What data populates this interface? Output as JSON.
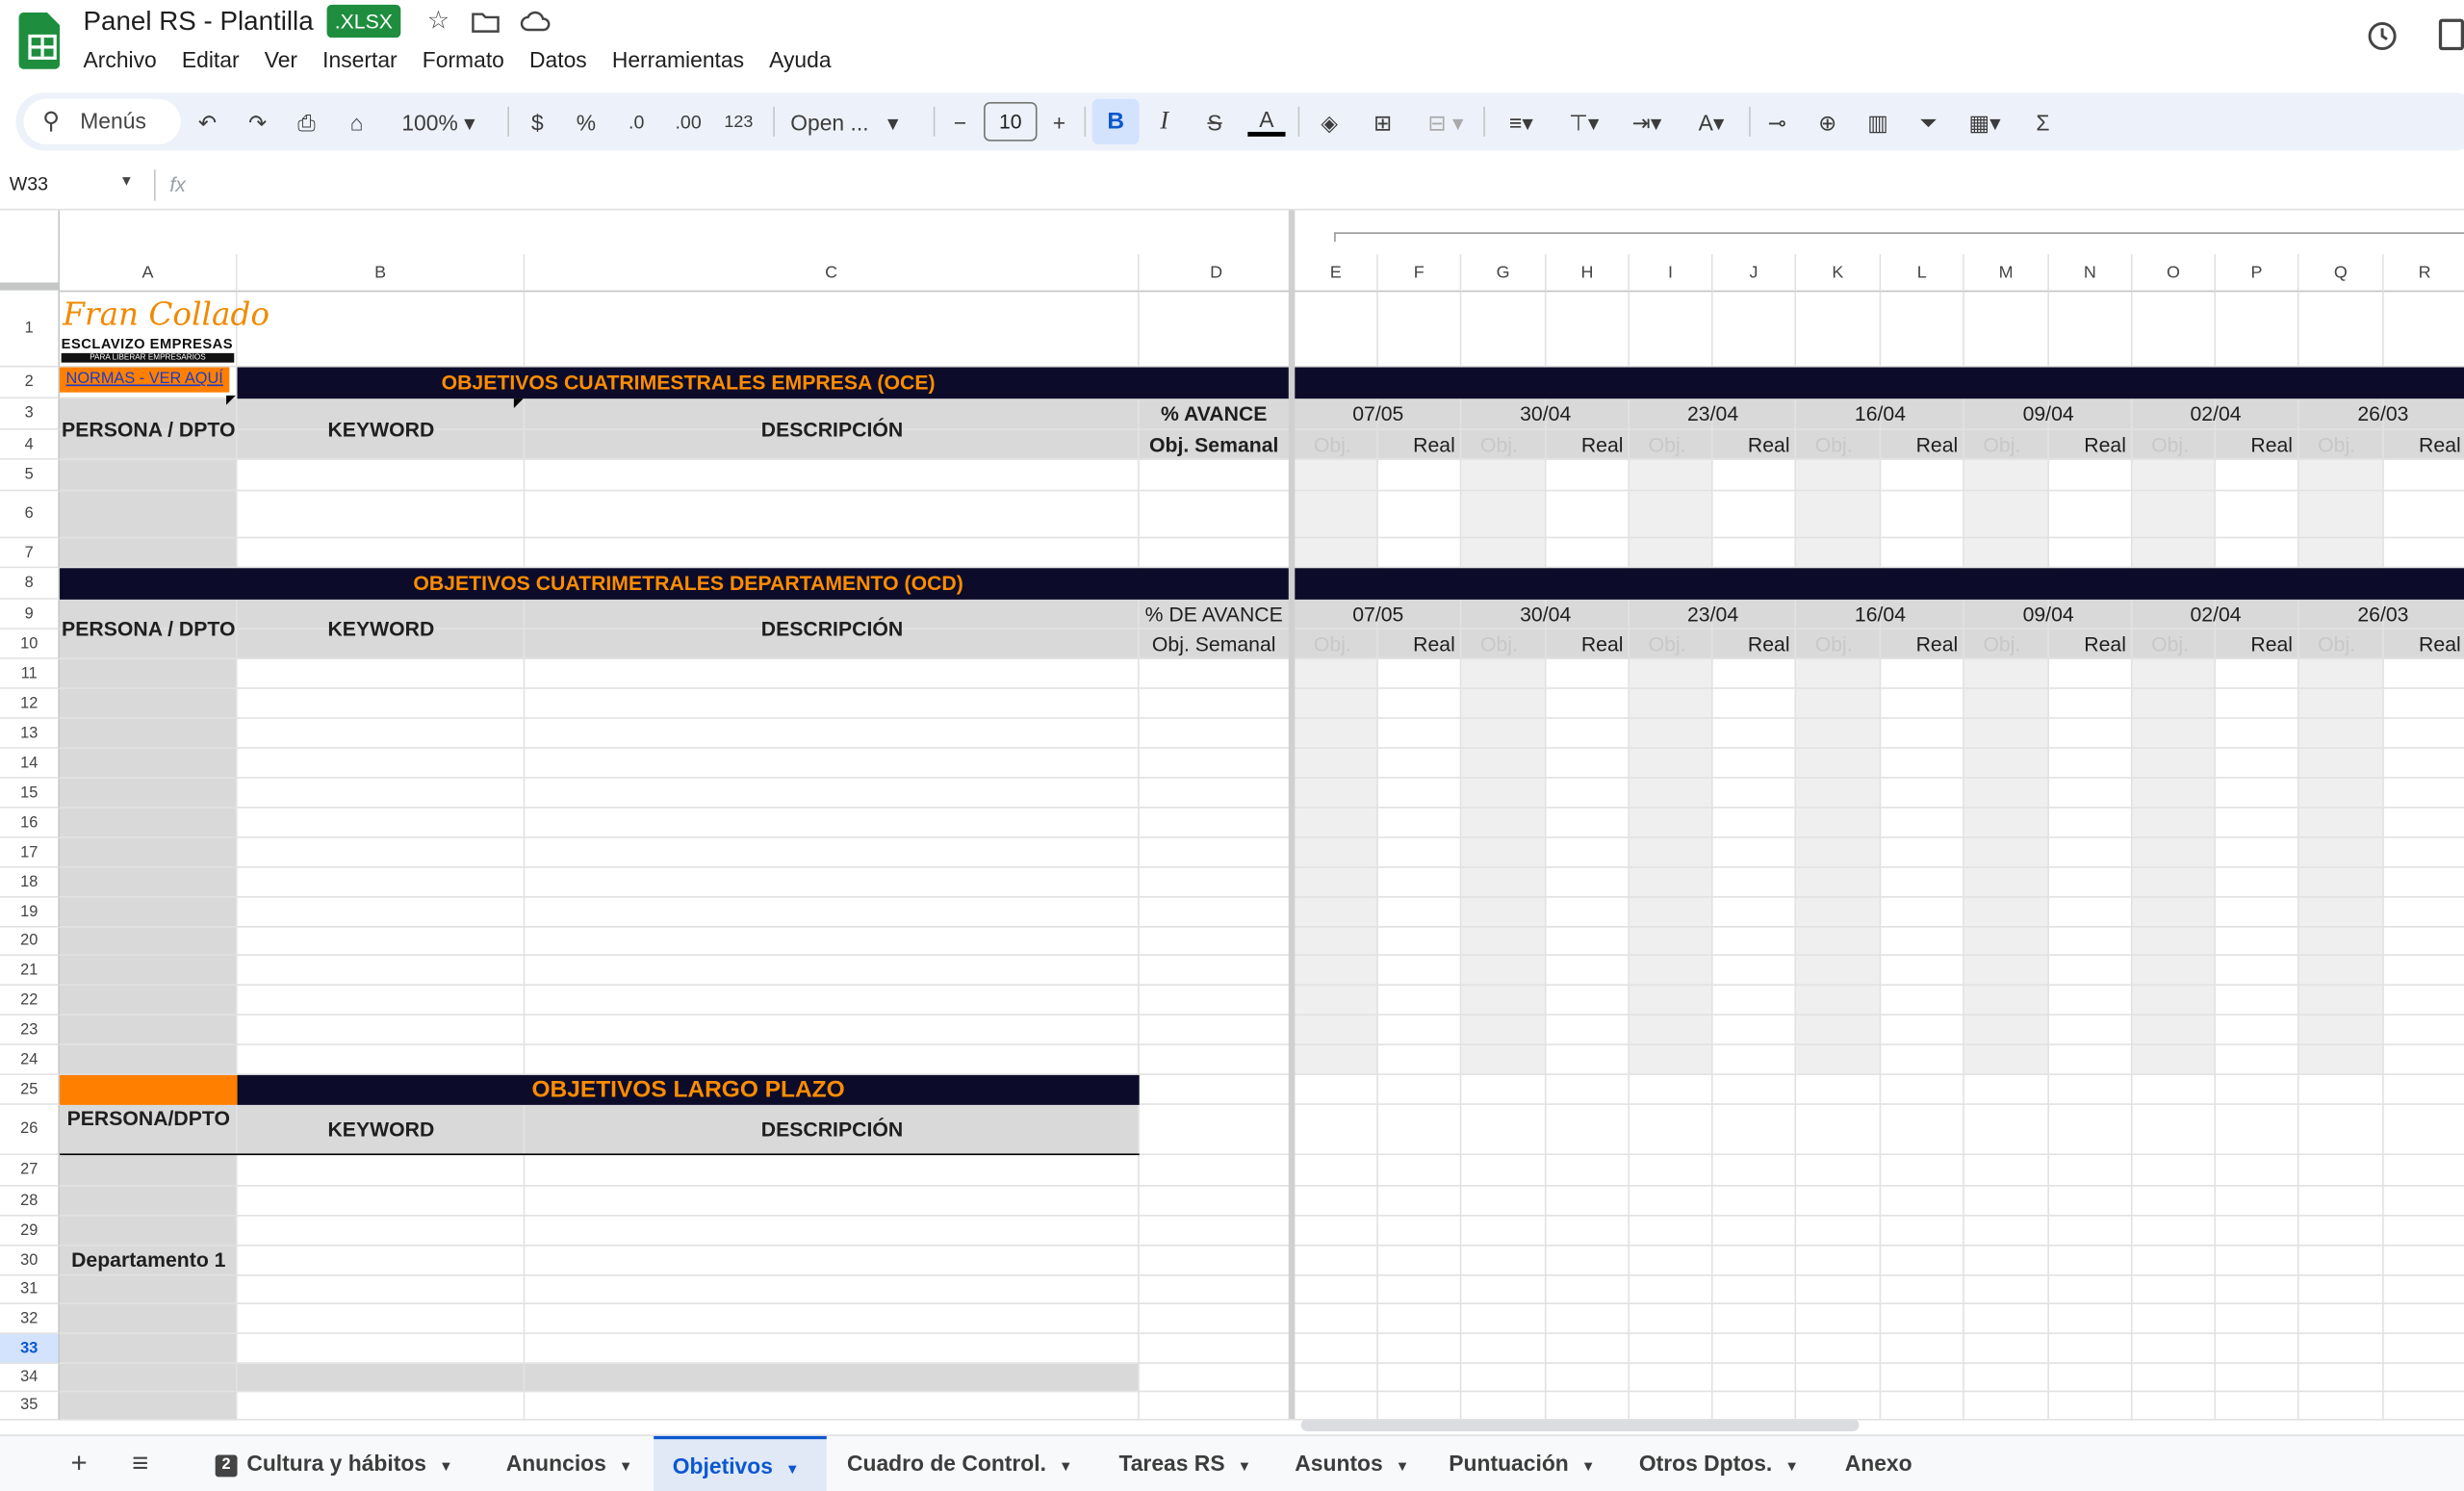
{
  "window": {
    "title": "Panel RS - Plantilla",
    "badge": ".XLSX"
  },
  "menu": [
    "Archivo",
    "Editar",
    "Ver",
    "Insertar",
    "Formato",
    "Datos",
    "Herramientas",
    "Ayuda"
  ],
  "toolbar": {
    "search_label": "Menús",
    "zoom": "100%",
    "currency": "$",
    "percent": "%",
    "dec_less": ".0",
    "dec_more": ".00",
    "number_format": "123",
    "font": "Open ...",
    "font_size": "10",
    "bold": "B",
    "italic": "I",
    "strike": "S",
    "text_color": "A",
    "sum": "Σ"
  },
  "formula_bar": {
    "name_box": "W33",
    "fx": "fx"
  },
  "columns": [
    "A",
    "B",
    "C",
    "D",
    "E",
    "F",
    "G",
    "H",
    "I",
    "J",
    "K",
    "L",
    "M",
    "N",
    "O",
    "P",
    "Q",
    "R"
  ],
  "rows": [
    "1",
    "2",
    "3",
    "4",
    "5",
    "6",
    "7",
    "8",
    "9",
    "10",
    "11",
    "12",
    "13",
    "14",
    "15",
    "16",
    "17",
    "18",
    "19",
    "20",
    "21",
    "22",
    "23",
    "24",
    "25",
    "26",
    "27",
    "28",
    "29",
    "30",
    "31",
    "32",
    "33",
    "34",
    "35"
  ],
  "selected_row": "33",
  "logo": {
    "script": "Fran Collado",
    "line1": "ESCLAVIZO EMPRESAS",
    "line2": "PARA LIBERAR EMPRESARIOS",
    "norms_link": "NORMAS - VER AQUÍ"
  },
  "section1": {
    "title": "OBJETIVOS CUATRIMESTRALES EMPRESA (OCE)",
    "persona": "PERSONA / DPTO",
    "keyword": "KEYWORD",
    "descripcion": "DESCRIPCIÓN",
    "avance_1": "% AVANCE",
    "avance_2": "Obj. Semanal"
  },
  "section2": {
    "title": "OBJETIVOS CUATRIMETRALES DEPARTAMENTO (OCD)",
    "persona": "PERSONA / DPTO",
    "keyword": "KEYWORD",
    "descripcion": "DESCRIPCIÓN",
    "avance_1": "% DE AVANCE",
    "avance_2": "Obj. Semanal"
  },
  "section3": {
    "title": "OBJETIVOS LARGO PLAZO",
    "persona": "PERSONA/DPTO",
    "keyword": "KEYWORD",
    "descripcion": "DESCRIPCIÓN",
    "dept": "Departamento 1"
  },
  "weeks": [
    "07/05",
    "30/04",
    "23/04",
    "16/04",
    "09/04",
    "02/04",
    "26/03"
  ],
  "obj_label": "Obj.",
  "real_label": "Real",
  "sheet_tabs": [
    {
      "label": "Cultura y hábitos",
      "badge": "2"
    },
    {
      "label": "Anuncios"
    },
    {
      "label": "Objetivos",
      "active": true
    },
    {
      "label": "Cuadro de Control."
    },
    {
      "label": "Tareas RS"
    },
    {
      "label": "Asuntos"
    },
    {
      "label": "Puntuación"
    },
    {
      "label": "Otros Dptos."
    },
    {
      "label": "Anexo Asuntos"
    }
  ]
}
